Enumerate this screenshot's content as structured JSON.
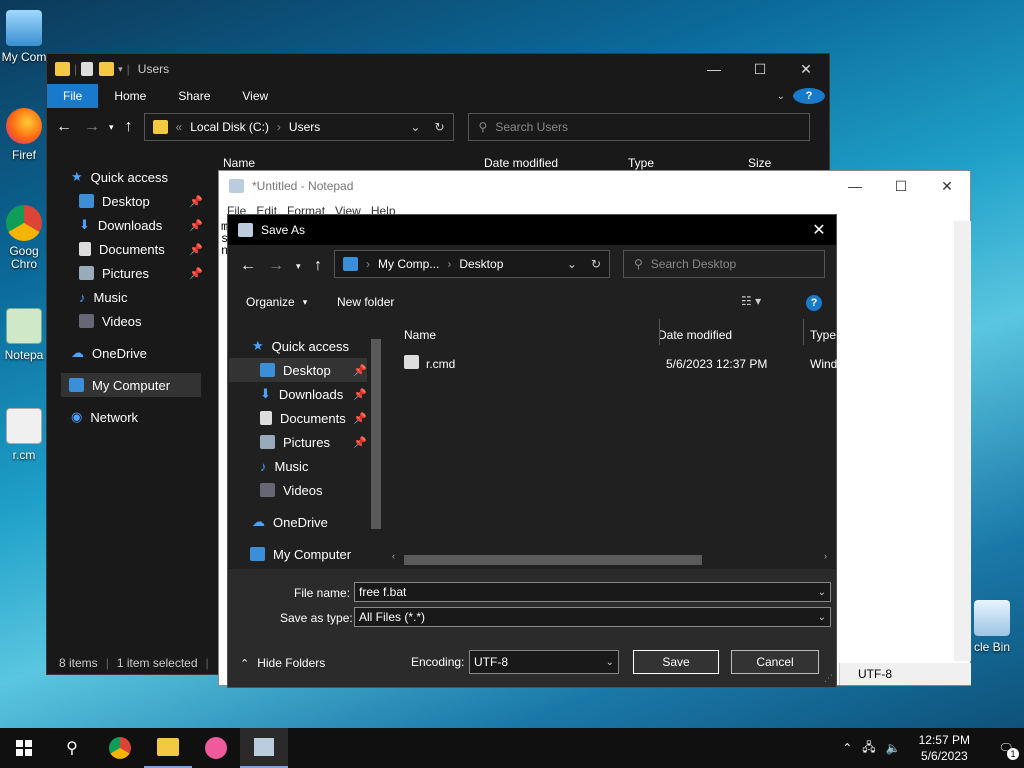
{
  "desktop": {
    "icons": [
      {
        "label": "My Com",
        "icon": "monitor-icon"
      },
      {
        "label": "Firef",
        "icon": "firefox-icon"
      },
      {
        "label": "Goog Chro",
        "icon": "chrome-icon"
      },
      {
        "label": "Notepa",
        "icon": "notepad-icon"
      },
      {
        "label": "r.cm",
        "icon": "script-icon"
      },
      {
        "label": "cle Bin",
        "icon": "recycle-bin-icon"
      }
    ]
  },
  "explorer": {
    "title": "Users",
    "ribbon": {
      "file": "File",
      "home": "Home",
      "share": "Share",
      "view": "View"
    },
    "address": {
      "root": "Local Disk (C:)",
      "current": "Users"
    },
    "search_placeholder": "Search Users",
    "columns": {
      "name": "Name",
      "date": "Date modified",
      "type": "Type",
      "size": "Size"
    },
    "sidebar": [
      {
        "label": "Quick access"
      },
      {
        "label": "Desktop"
      },
      {
        "label": "Downloads"
      },
      {
        "label": "Documents"
      },
      {
        "label": "Pictures"
      },
      {
        "label": "Music"
      },
      {
        "label": "Videos"
      },
      {
        "label": "OneDrive"
      },
      {
        "label": "My Computer"
      },
      {
        "label": "Network"
      }
    ],
    "status": {
      "items": "8 items",
      "selected": "1 item selected"
    }
  },
  "notepad": {
    "title": "*Untitled - Notepad",
    "menu": [
      "File",
      "Edit",
      "Format",
      "View",
      "Help"
    ],
    "text_fragments": [
      "m",
      "s",
      "n"
    ],
    "encoding_status": "UTF-8"
  },
  "dialog": {
    "title": "Save As",
    "address": {
      "root": "My Comp...",
      "current": "Desktop"
    },
    "search_placeholder": "Search Desktop",
    "organize": "Organize",
    "new_folder": "New folder",
    "columns": {
      "name": "Name",
      "date": "Date modified",
      "type": "Type"
    },
    "files": [
      {
        "name": "r.cmd",
        "date": "5/6/2023 12:37 PM",
        "type": "Wind"
      }
    ],
    "sidebar": [
      {
        "label": "Quick access"
      },
      {
        "label": "Desktop"
      },
      {
        "label": "Downloads"
      },
      {
        "label": "Documents"
      },
      {
        "label": "Pictures"
      },
      {
        "label": "Music"
      },
      {
        "label": "Videos"
      },
      {
        "label": "OneDrive"
      },
      {
        "label": "My Computer"
      }
    ],
    "file_name_label": "File name:",
    "file_name_value": "free f.bat",
    "save_type_label": "Save as type:",
    "save_type_value": "All Files  (*.*)",
    "hide_folders": "Hide Folders",
    "encoding_label": "Encoding:",
    "encoding_value": "UTF-8",
    "save": "Save",
    "cancel": "Cancel"
  },
  "taskbar": {
    "time": "12:57 PM",
    "date": "5/6/2023",
    "notification_count": "1"
  }
}
